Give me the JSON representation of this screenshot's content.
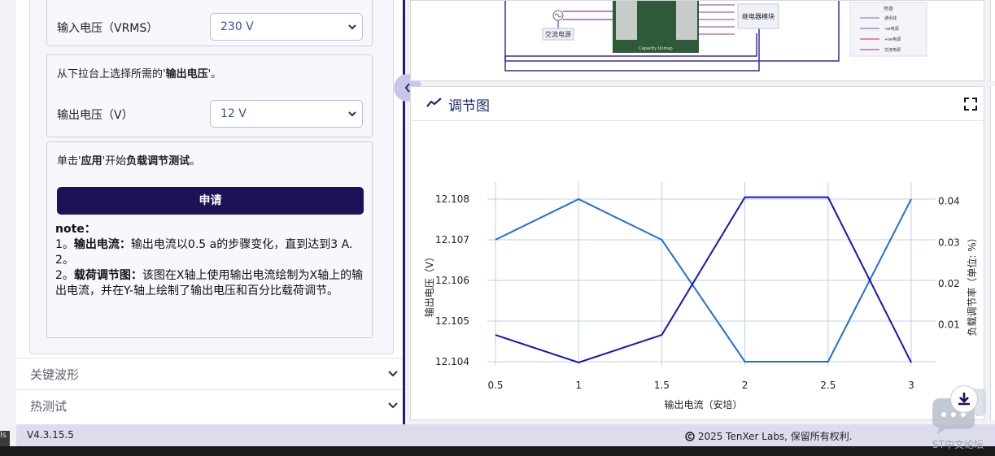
{
  "settings": {
    "input_voltage": {
      "label": "输入电压（VRMS）",
      "value": "230 V"
    },
    "output_prompt": {
      "prefix": "从下拉台上选择所需的'",
      "bold": "输出电压",
      "suffix": "'。"
    },
    "output_voltage": {
      "label": "输出电压（V）",
      "value": "12 V"
    },
    "apply_hint": {
      "p1": "单击'",
      "b1": "应用",
      "p2": "'开始",
      "b2": "负载调节测试",
      "p3": "。"
    },
    "apply_button": "申请",
    "note": {
      "title": "note：",
      "item1_prefix": "1。",
      "item1_bold": "输出电流：",
      "item1_text": "输出电流以0.5 a的步骤变化，直到达到3 A.",
      "item2": "2。",
      "item3_prefix": "2。",
      "item3_bold": "载荷调节图：",
      "item3_text": "该图在X轴上使用输出电流绘制为X轴上的输出电流，并在Y-轴上绘制了输出电压和百分比载荷调节。"
    }
  },
  "accordions": [
    "关键波形",
    "热测试"
  ],
  "diagram": {
    "ac_label": "交流电源",
    "relay_label": "继电器模块",
    "board_label": "Capacity Unmap",
    "legend_title": "传奇",
    "legend_items": [
      "通讯线",
      "-ve电源",
      "+ve电源",
      "交流电源"
    ],
    "legend_colors": [
      "#8a8fb0",
      "#6b7fd0",
      "#d04a6a",
      "#a050b0"
    ]
  },
  "chart_panel": {
    "title": "调节图"
  },
  "chart_data": {
    "type": "line",
    "x": [
      0.5,
      1,
      1.5,
      2,
      2.5,
      3
    ],
    "xlabel": "输出电流（安培）",
    "ylabel": "输出电压（V）",
    "y2label": "负载调节率（单位: %）",
    "ylim": [
      12.1039,
      12.1083
    ],
    "y2lim": [
      0.0,
      0.0435
    ],
    "x_ticks": [
      "0.5",
      "1",
      "1.5",
      "2",
      "2.5",
      "3"
    ],
    "y_ticks": [
      "12.104",
      "12.105",
      "12.106",
      "12.107",
      "12.108"
    ],
    "y2_ticks": [
      "0.01",
      "0.02",
      "0.03",
      "0.04"
    ],
    "series": [
      {
        "axis": "y",
        "color": "#1f6fd9",
        "values": [
          12.107,
          12.108,
          12.107,
          12.104,
          12.104,
          12.108
        ]
      },
      {
        "axis": "y2",
        "color": "#1a10c8",
        "values": [
          0.0075,
          0.0008,
          0.0075,
          0.041,
          0.041,
          0.0008
        ]
      }
    ]
  },
  "footer": {
    "version": "V4.3.15.5",
    "copyright": "2025 TenXer Labs, 保留所有权利."
  },
  "watermark": "ST中文论坛",
  "left_strip": "ls"
}
